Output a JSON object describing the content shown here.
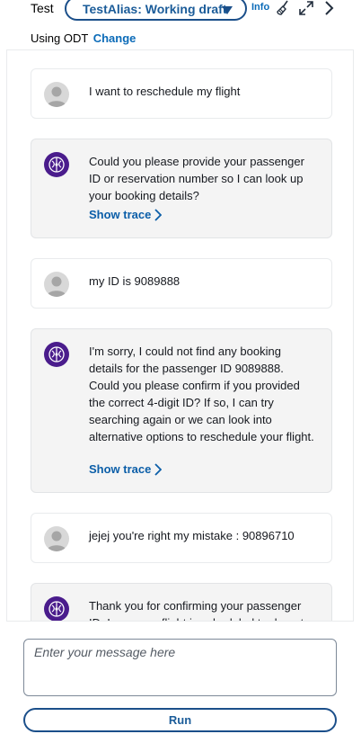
{
  "header": {
    "title": "Test",
    "alias_select_value": "TestAlias: Working draft",
    "info_label": "Info",
    "using_label": "Using ODT",
    "change_label": "Change"
  },
  "icons": {
    "alias_caret": "caret-down-icon",
    "clear": "broom-icon",
    "expand": "expand-icon",
    "close": "chevron-right-icon",
    "user_avatar": "user-avatar-icon",
    "bot_avatar": "agent-brain-icon"
  },
  "messages": [
    {
      "role": "user",
      "text": "I want to reschedule my flight"
    },
    {
      "role": "bot",
      "text": "Could you please provide your passenger ID or reservation number so I can look up your booking details?",
      "trace_label": "Show trace"
    },
    {
      "role": "user",
      "text": "my ID is 9089888"
    },
    {
      "role": "bot",
      "text": "I'm sorry, I could not find any booking details for the passenger ID 9089888. Could you please confirm if you provided the correct 4-digit ID? If so, I can try searching again or we can look into alternative options to reschedule your flight.",
      "trace_label": "Show trace"
    },
    {
      "role": "user",
      "text": "jejej you're right my mistake : 90896710"
    },
    {
      "role": "bot",
      "text": "Thank you for confirming your passenger ID. I see your flight is scheduled to depart"
    }
  ],
  "composer": {
    "placeholder": "Enter your message here",
    "value": "",
    "run_label": "Run"
  },
  "colors": {
    "link": "#0b6bb8",
    "button_border": "#1b4f8a",
    "bot_bubble": "#f4f4f4",
    "bot_avatar": "#4a1c8c"
  }
}
